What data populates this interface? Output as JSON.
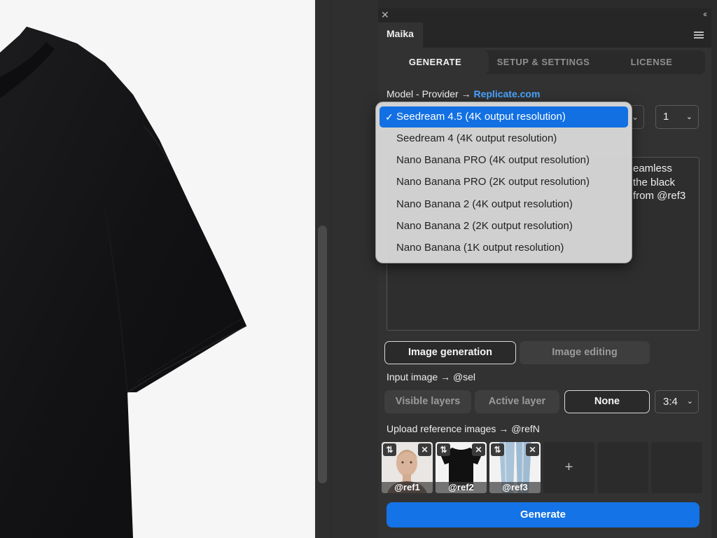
{
  "panel": {
    "title": "Maika",
    "close_icon": "close-icon",
    "collapse_icon": "double-chevron-left-icon",
    "menu_icon": "hamburger-menu-icon"
  },
  "tabs": [
    {
      "label": "GENERATE",
      "active": true
    },
    {
      "label": "SETUP & SETTINGS",
      "active": false
    },
    {
      "label": "LICENSE",
      "active": false
    }
  ],
  "model": {
    "label": "Model - Provider → ",
    "provider_link": "Replicate.com",
    "options": [
      {
        "label": "Seedream 4.5 (4K output resolution)",
        "selected": true
      },
      {
        "label": "Seedream 4 (4K output resolution)",
        "selected": false
      },
      {
        "label": "Nano Banana PRO (4K output resolution)",
        "selected": false
      },
      {
        "label": "Nano Banana PRO (2K output resolution)",
        "selected": false
      },
      {
        "label": "Nano Banana 2 (4K output resolution)",
        "selected": false
      },
      {
        "label": "Nano Banana 2 (2K output resolution)",
        "selected": false
      },
      {
        "label": "Nano Banana (1K output resolution)",
        "selected": false
      }
    ],
    "check": "✓"
  },
  "count": {
    "value": "1"
  },
  "prompt": {
    "visible_text": "eamless\nthe black\nfrom @ref3"
  },
  "mode": {
    "options": [
      {
        "label": "Image generation",
        "active": true
      },
      {
        "label": "Image editing",
        "active": false
      }
    ]
  },
  "input_image": {
    "label": "Input image → @sel",
    "options": [
      {
        "label": "Visible layers",
        "active": false
      },
      {
        "label": "Active layer",
        "active": false
      },
      {
        "label": "None",
        "active": true
      }
    ],
    "ratio": "3:4"
  },
  "references": {
    "label": "Upload reference images → @refN",
    "items": [
      {
        "tag": "@ref1",
        "kind": "portrait"
      },
      {
        "tag": "@ref2",
        "kind": "black-tshirt"
      },
      {
        "tag": "@ref3",
        "kind": "jeans"
      }
    ],
    "add_label": "+",
    "swap_glyph": "⇅",
    "remove_glyph": "✕"
  },
  "generate_label": "Generate",
  "colors": {
    "accent": "#1473e6",
    "link": "#4aa3ff",
    "panel_bg": "#323232"
  }
}
